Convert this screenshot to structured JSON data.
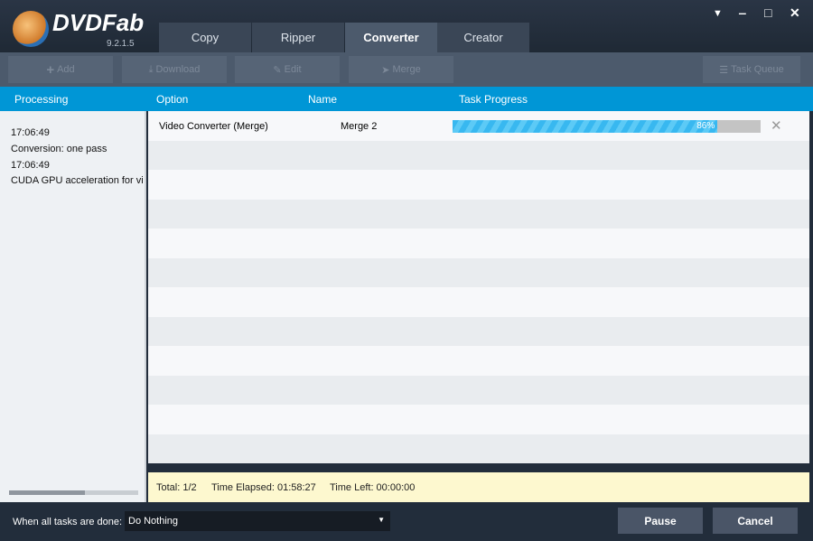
{
  "app": {
    "brand": "DVDFab",
    "version": "9.2.1.5"
  },
  "tabs": [
    {
      "label": "Copy"
    },
    {
      "label": "Ripper"
    },
    {
      "label": "Converter"
    },
    {
      "label": "Creator"
    }
  ],
  "toolbar": {
    "add": "Add",
    "download": "Download",
    "edit": "Edit",
    "merge": "Merge",
    "task_queue": "Task Queue"
  },
  "columns": {
    "processing": "Processing",
    "option": "Option",
    "name": "Name",
    "progress": "Task Progress"
  },
  "log": [
    "17:06:49",
    "Conversion: one pass",
    "17:06:49",
    "CUDA GPU acceleration for vid"
  ],
  "tasks": [
    {
      "option": "Video Converter (Merge)",
      "name": "Merge 2",
      "progress_label": "86%",
      "progress": 86
    }
  ],
  "status": {
    "total": "Total: 1/2",
    "elapsed": "Time Elapsed: 01:58:27",
    "left": "Time Left: 00:00:00"
  },
  "footer": {
    "when_done_label": "When all tasks are done:",
    "when_done_value": "Do Nothing",
    "pause": "Pause",
    "cancel": "Cancel"
  }
}
